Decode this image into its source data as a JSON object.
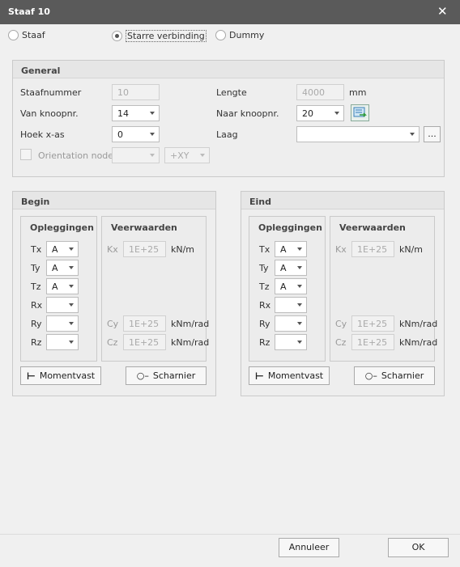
{
  "window": {
    "title": "Staaf 10"
  },
  "type_options": [
    {
      "label": "Staaf",
      "selected": false
    },
    {
      "label": "Starre verbinding",
      "selected": true
    },
    {
      "label": "Dummy",
      "selected": false
    }
  ],
  "general": {
    "title": "General",
    "staafnummer_label": "Staafnummer",
    "staafnummer_value": "10",
    "lengte_label": "Lengte",
    "lengte_value": "4000",
    "lengte_unit": "mm",
    "van_label": "Van knoopnr.",
    "van_value": "14",
    "naar_label": "Naar knoopnr.",
    "naar_value": "20",
    "hoek_label": "Hoek x-as",
    "hoek_value": "0",
    "laag_label": "Laag",
    "laag_value": "",
    "laag_button": "...",
    "orientation_label": "Orientation node",
    "orientation_value": "",
    "orientation_axis": "+XY"
  },
  "begin": {
    "title": "Begin",
    "opleggingen": "Opleggingen",
    "veerwaarden": "Veerwaarden",
    "supports": [
      {
        "label": "Tx",
        "value": "A"
      },
      {
        "label": "Ty",
        "value": "A"
      },
      {
        "label": "Tz",
        "value": "A"
      },
      {
        "label": "Rx",
        "value": ""
      },
      {
        "label": "Ry",
        "value": ""
      },
      {
        "label": "Rz",
        "value": ""
      }
    ],
    "springs": {
      "kx": {
        "label": "Kx",
        "value": "1E+25",
        "unit": "kN/m"
      },
      "cy": {
        "label": "Cy",
        "value": "1E+25",
        "unit": "kNm/rad"
      },
      "cz": {
        "label": "Cz",
        "value": "1E+25",
        "unit": "kNm/rad"
      }
    },
    "momentvast": "Momentvast",
    "scharnier": "Scharnier"
  },
  "eind": {
    "title": "Eind",
    "opleggingen": "Opleggingen",
    "veerwaarden": "Veerwaarden",
    "supports": [
      {
        "label": "Tx",
        "value": "A"
      },
      {
        "label": "Ty",
        "value": "A"
      },
      {
        "label": "Tz",
        "value": "A"
      },
      {
        "label": "Rx",
        "value": ""
      },
      {
        "label": "Ry",
        "value": ""
      },
      {
        "label": "Rz",
        "value": ""
      }
    ],
    "springs": {
      "kx": {
        "label": "Kx",
        "value": "1E+25",
        "unit": "kN/m"
      },
      "cy": {
        "label": "Cy",
        "value": "1E+25",
        "unit": "kNm/rad"
      },
      "cz": {
        "label": "Cz",
        "value": "1E+25",
        "unit": "kNm/rad"
      }
    },
    "momentvast": "Momentvast",
    "scharnier": "Scharnier"
  },
  "footer": {
    "cancel": "Annuleer",
    "ok": "OK"
  }
}
